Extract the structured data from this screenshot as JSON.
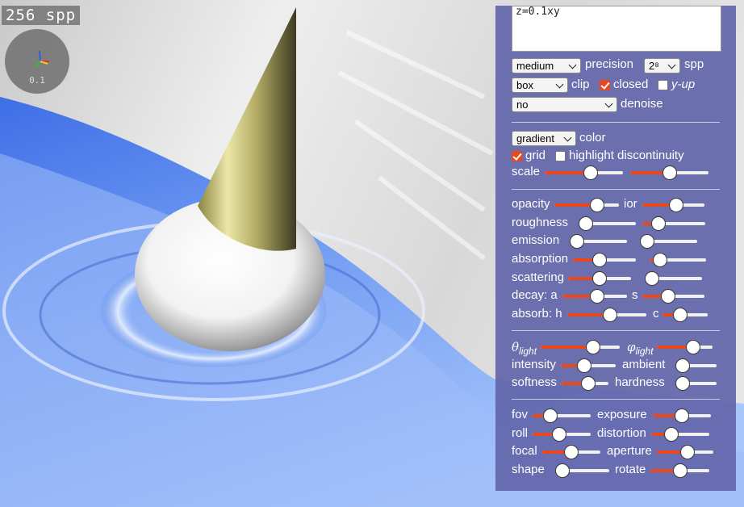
{
  "overlay": {
    "spp_label": "256 spp",
    "gizmo_scale": "0.1"
  },
  "editor": {
    "code": "z=0.1xy"
  },
  "render": {
    "precision": {
      "value": "medium",
      "label": "precision"
    },
    "spp": {
      "value": "2⁸",
      "label": "spp"
    },
    "clip": {
      "value": "box",
      "label": "clip"
    },
    "closed": {
      "label": "closed",
      "checked": true
    },
    "y_up": {
      "label": "y-up",
      "checked": false
    },
    "denoise": {
      "value": "no",
      "label": "denoise"
    }
  },
  "color": {
    "mode": {
      "value": "gradient",
      "label": "color"
    },
    "grid": {
      "label": "grid",
      "checked": true
    },
    "highlight": {
      "label": "highlight discontinuity",
      "checked": false
    },
    "scale_label": "scale",
    "scale_a": 0.6,
    "scale_b": 0.5
  },
  "material": {
    "opacity": {
      "label": "opacity",
      "value": 0.7
    },
    "ior": {
      "label": "ior",
      "value": 0.55
    },
    "roughness": {
      "label": "roughness",
      "value": 0.0
    },
    "roughness2": {
      "value": 0.2
    },
    "emission": {
      "label": "emission",
      "value": 0.0
    },
    "emission2": {
      "value": 0.0
    },
    "absorption": {
      "label": "absorption",
      "value": 0.4
    },
    "absorption2": {
      "value": 0.1
    },
    "scattering": {
      "label": "scattering",
      "value": 0.5
    },
    "scattering2": {
      "value": 0.0
    },
    "decay_a": {
      "label": "decay: a",
      "value": 0.55
    },
    "decay_s": {
      "label": "s",
      "value": 0.4
    },
    "absorb_h": {
      "label": "absorb: h",
      "value": 0.55
    },
    "absorb_c": {
      "label": "c",
      "value": 0.35
    }
  },
  "lighting": {
    "theta": {
      "symbol": "θ",
      "sub": "light",
      "value": 0.7
    },
    "phi": {
      "symbol": "φ",
      "sub": "light",
      "value": 0.7
    },
    "intensity": {
      "label": "intensity",
      "value": 0.4
    },
    "ambient": {
      "label": "ambient",
      "value": 0.0
    },
    "softness": {
      "label": "softness",
      "value": 0.6
    },
    "hardness": {
      "label": "hardness",
      "value": 0.0
    }
  },
  "camera": {
    "fov": {
      "label": "fov",
      "value": 0.25
    },
    "exposure": {
      "label": "exposure",
      "value": 0.5
    },
    "roll": {
      "label": "roll",
      "value": 0.45
    },
    "distortion": {
      "label": "distortion",
      "value": 0.3
    },
    "focal": {
      "label": "focal",
      "value": 0.5
    },
    "aperture": {
      "label": "aperture",
      "value": 0.55
    },
    "shape": {
      "label": "shape",
      "value": 0.0
    },
    "rotate": {
      "label": "rotate",
      "value": 0.5
    }
  },
  "colors": {
    "accent": "#e8481c",
    "panel": "#6266aa",
    "surface_blue": "#6f9cf0",
    "cone_gold": "#c9c07a"
  }
}
